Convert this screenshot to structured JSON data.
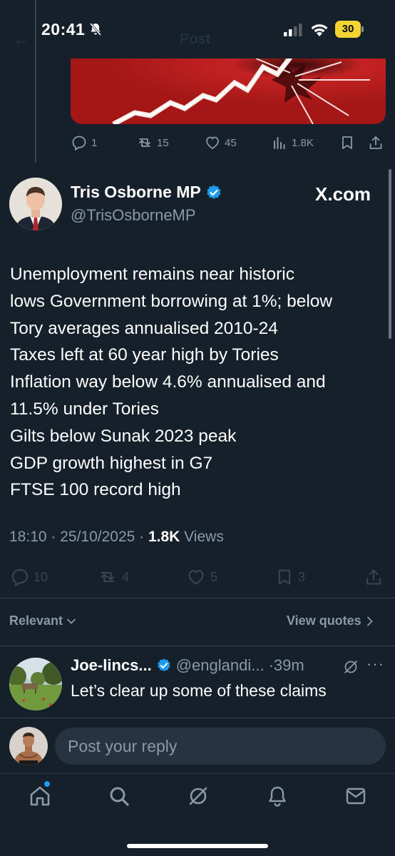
{
  "status_bar": {
    "time": "20:41",
    "battery": "30",
    "icons": [
      "bell-slash-icon",
      "cellular-signal-icon",
      "wifi-icon",
      "battery-icon"
    ]
  },
  "header": {
    "title": "Post",
    "back_icon": "back-arrow-icon"
  },
  "previous_post": {
    "image_icon": "rising-arrow-graphic",
    "actions": {
      "replies": "1",
      "reposts": "15",
      "likes": "45",
      "views": "1.8K"
    }
  },
  "main_post": {
    "author_name": "Tris Osborne MP",
    "author_handle": "@TrisOsborneMP",
    "watermark": "X.com",
    "lines": [
      "Unemployment remains near historic",
      "lows Government borrowing at 1%; below",
      "Tory averages annualised 2010-24",
      "Taxes left at 60 year high by Tories",
      "Inflation way below 4.6% annualised and",
      "11.5% under Tories",
      "Gilts below Sunak 2023 peak",
      "GDP growth highest in G7",
      "FTSE 100 record high"
    ],
    "timestamp": "18:10 · 25/10/2025 · ",
    "views_count": "1.8K",
    "views_label": " Views",
    "actions": {
      "replies": "10",
      "reposts": "4",
      "likes": "5",
      "bookmarks": "3"
    }
  },
  "sort": {
    "label": "Relevant",
    "view_quotes": "View quotes"
  },
  "reply": {
    "name": "Joe-lincs...",
    "handle": "@englandi...",
    "time": "·39m",
    "more": "···",
    "text": "Let’s clear up some of these claims"
  },
  "compose": {
    "placeholder": "Post your reply"
  },
  "tab_bar": [
    "home-icon",
    "search-icon",
    "grok-icon",
    "notifications-icon",
    "messages-icon"
  ],
  "colors": {
    "background": "#15202b",
    "secondary_text": "#8b98a5",
    "accent": "#1d9bf0",
    "battery": "#f4d431"
  }
}
